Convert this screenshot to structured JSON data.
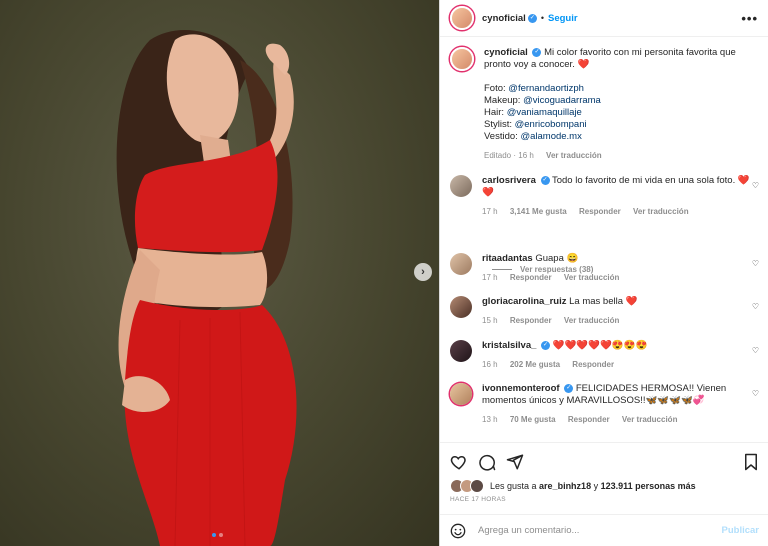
{
  "post": {
    "username": "cynoficial",
    "follow_label": "Seguir",
    "separator": "•",
    "more_label": "•••",
    "caption_text": "Mi color favorito con mi personita favorita que pronto voy a conocer. ❤️",
    "credits": [
      {
        "label": "Foto: ",
        "handle": "@fernandaortizph"
      },
      {
        "label": "Makeup: ",
        "handle": "@vicoguadarrama"
      },
      {
        "label": "Hair: ",
        "handle": "@vaniamaquillaje"
      },
      {
        "label": "Stylist: ",
        "handle": "@enricobompani"
      },
      {
        "label": "Vestido: ",
        "handle": "@alamode.mx"
      }
    ],
    "edited": "Editado · 16 h",
    "see_translation": "Ver traducción"
  },
  "comments": [
    {
      "user": "carlosrivera",
      "verified": true,
      "text": "Todo lo favorito de mi vida en una sola foto. ❤️❤️",
      "time": "17 h",
      "likes": "3,141 Me gusta",
      "reply": "Responder",
      "translate": "Ver traducción",
      "view_replies": "Ver respuestas (38)"
    },
    {
      "user": "ritaadantas",
      "verified": false,
      "text": "Guapa 😄",
      "time": "17 h",
      "likes": "",
      "reply": "Responder",
      "translate": "Ver traducción"
    },
    {
      "user": "gloriacarolina_ruiz",
      "verified": false,
      "text": "La mas bella ❤️",
      "time": "15 h",
      "likes": "",
      "reply": "Responder",
      "translate": "Ver traducción"
    },
    {
      "user": "kristalsilva_",
      "verified": true,
      "text": "❤️❤️❤️❤️❤️😍😍😍",
      "time": "16 h",
      "likes": "202 Me gusta",
      "reply": "Responder",
      "translate": ""
    },
    {
      "user": "ivonnemonteroof",
      "verified": true,
      "text": "FELICIDADES HERMOSA!! Vienen momentos únicos y MARAVILLOSOS!!🦋🦋🦋🦋💞",
      "time": "13 h",
      "likes": "70 Me gusta",
      "reply": "Responder",
      "translate": "Ver traducción"
    }
  ],
  "likes_bar": {
    "prefix": "Les gusta a ",
    "user": "are_binhz18",
    "middle": " y ",
    "count": "123.911 personas más",
    "ago": "HACE 17 HORAS"
  },
  "add_comment": {
    "placeholder": "Agrega un comentario...",
    "publish": "Publicar"
  },
  "icons": [
    "heart-icon",
    "comment-icon",
    "share-icon",
    "bookmark-icon",
    "emoji-icon",
    "chevron-right-icon"
  ],
  "colors": {
    "accent": "#0095f6",
    "dress": "#d7191c",
    "background": "#47462f"
  },
  "carousel": {
    "total": 2,
    "active": 1
  }
}
